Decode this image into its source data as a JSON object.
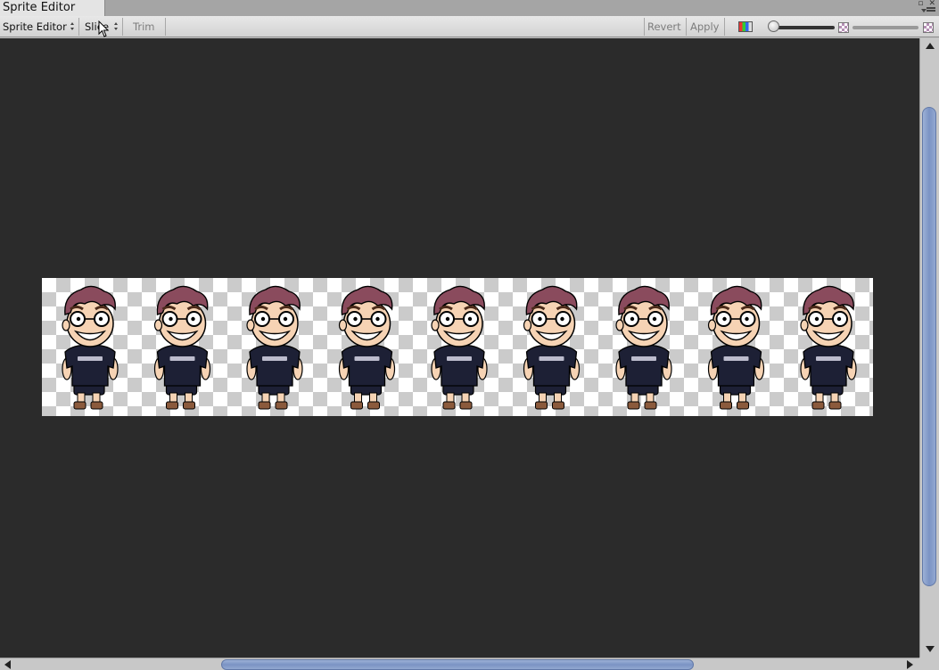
{
  "window": {
    "tab_title": "Sprite Editor"
  },
  "toolbar": {
    "mode_dropdown": "Sprite Editor",
    "slice_dropdown": "Slice",
    "trim_label": "Trim",
    "revert_label": "Revert",
    "apply_label": "Apply"
  },
  "sprite_sheet": {
    "frame_count": 9,
    "shirt_text": "dicoding"
  },
  "colors": {
    "canvas_bg": "#2b2b2b",
    "hair": "#8a4b5d",
    "skin": "#f6d3b4",
    "shirt": "#1d2035",
    "shoes": "#8b5a3c",
    "scroll_thumb": "#8aa0cc"
  }
}
